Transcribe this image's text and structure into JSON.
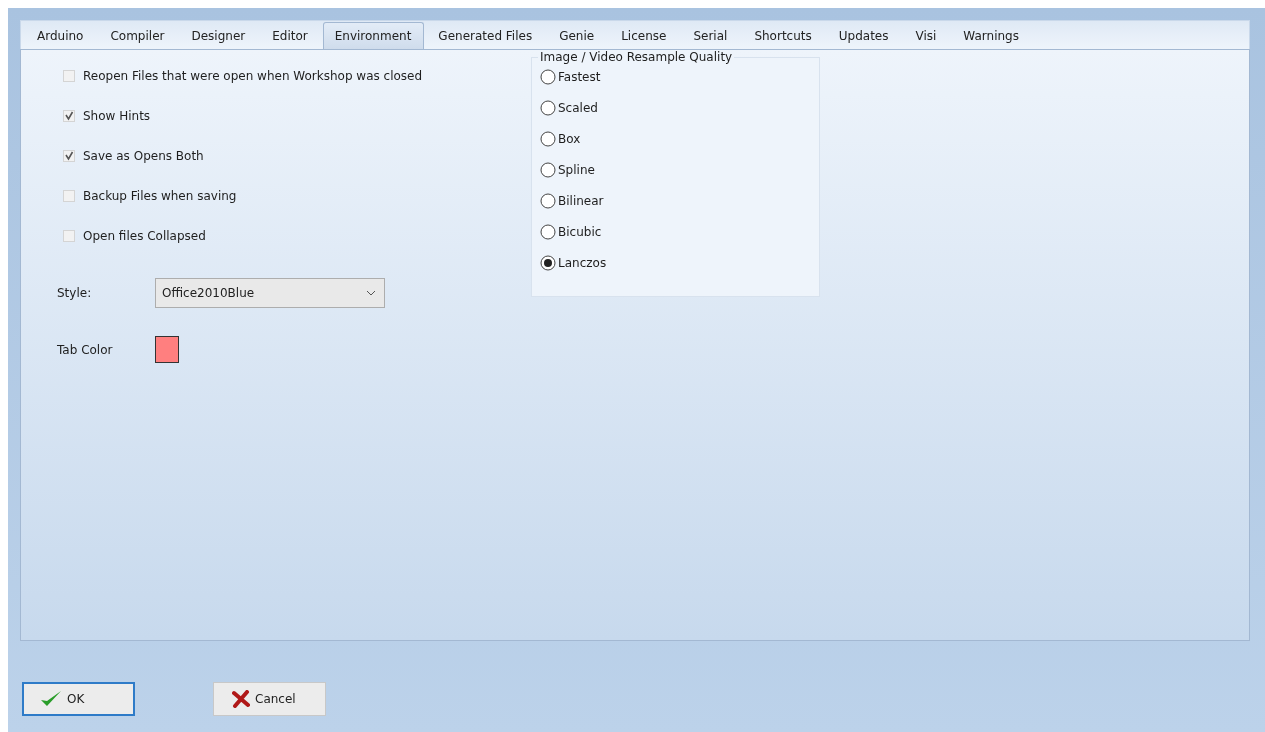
{
  "tabs": [
    {
      "label": "Arduino",
      "selected": false
    },
    {
      "label": "Compiler",
      "selected": false
    },
    {
      "label": "Designer",
      "selected": false
    },
    {
      "label": "Editor",
      "selected": false
    },
    {
      "label": "Environment",
      "selected": true
    },
    {
      "label": "Generated Files",
      "selected": false
    },
    {
      "label": "Genie",
      "selected": false
    },
    {
      "label": "License",
      "selected": false
    },
    {
      "label": "Serial",
      "selected": false
    },
    {
      "label": "Shortcuts",
      "selected": false
    },
    {
      "label": "Updates",
      "selected": false
    },
    {
      "label": "Visi",
      "selected": false
    },
    {
      "label": "Warnings",
      "selected": false
    }
  ],
  "options": [
    {
      "label": "Reopen Files that were open when Workshop was closed",
      "checked": false
    },
    {
      "label": "Show Hints",
      "checked": true
    },
    {
      "label": "Save as Opens Both",
      "checked": true
    },
    {
      "label": "Backup Files when saving",
      "checked": false
    },
    {
      "label": "Open files Collapsed",
      "checked": false
    }
  ],
  "style": {
    "label": "Style:",
    "value": "Office2010Blue"
  },
  "tab_color": {
    "label": "Tab Color",
    "color": "#ff7f7f"
  },
  "resample_quality": {
    "title": "Image / Video Resample Quality",
    "options": [
      {
        "label": "Fastest",
        "selected": false
      },
      {
        "label": "Scaled",
        "selected": false
      },
      {
        "label": "Box",
        "selected": false
      },
      {
        "label": "Spline",
        "selected": false
      },
      {
        "label": "Bilinear",
        "selected": false
      },
      {
        "label": "Bicubic",
        "selected": false
      },
      {
        "label": "Lanczos",
        "selected": true
      }
    ]
  },
  "buttons": [
    {
      "kind": "ok",
      "label": "OK"
    },
    {
      "kind": "cancel",
      "label": "Cancel"
    }
  ]
}
